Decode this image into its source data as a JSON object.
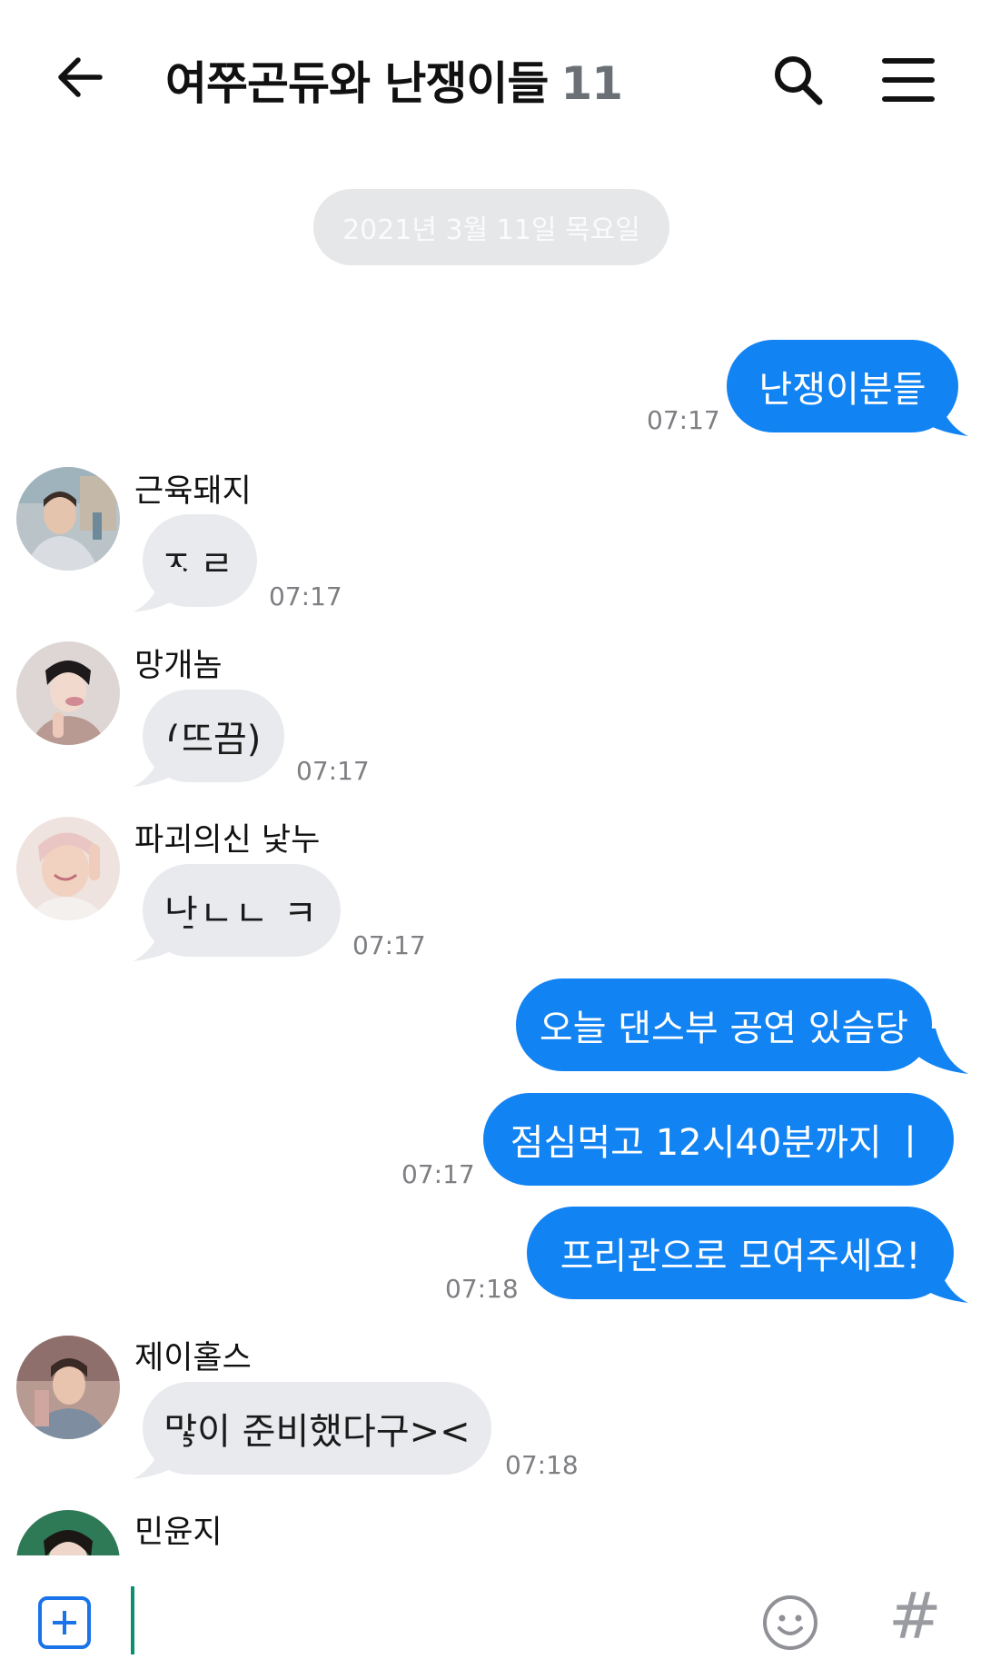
{
  "header": {
    "title": "여쭈곤듀와 난쟁이들",
    "member_count": "11"
  },
  "date_divider": "2021년 3월 11일 목요일",
  "messages": [
    {
      "text": "난쟁이분들",
      "time": "07:17"
    },
    {
      "sender": "근육돼지",
      "text": "ㅈㄹ",
      "time": "07:17"
    },
    {
      "sender": "망개놈",
      "text": "(뜨끔)",
      "time": "07:17"
    },
    {
      "sender": "파괴의신 낯누",
      "text": "난ㄴㄴ ㅋ",
      "time": "07:17"
    },
    {
      "text": "오늘 댄스부 공연 있슴당"
    },
    {
      "text": "점심먹고 12시40분까지 ㅣ",
      "time": "07:17"
    },
    {
      "text": "프리관으로 모여주세요!",
      "time": "07:18"
    },
    {
      "sender": "제이홀스",
      "text": "많이 준비했다구><",
      "time": "07:18"
    },
    {
      "sender": "민윤지"
    }
  ],
  "input": {
    "placeholder": ""
  },
  "colors": {
    "accent": "#1283f2",
    "incoming": "#e9eaee"
  }
}
